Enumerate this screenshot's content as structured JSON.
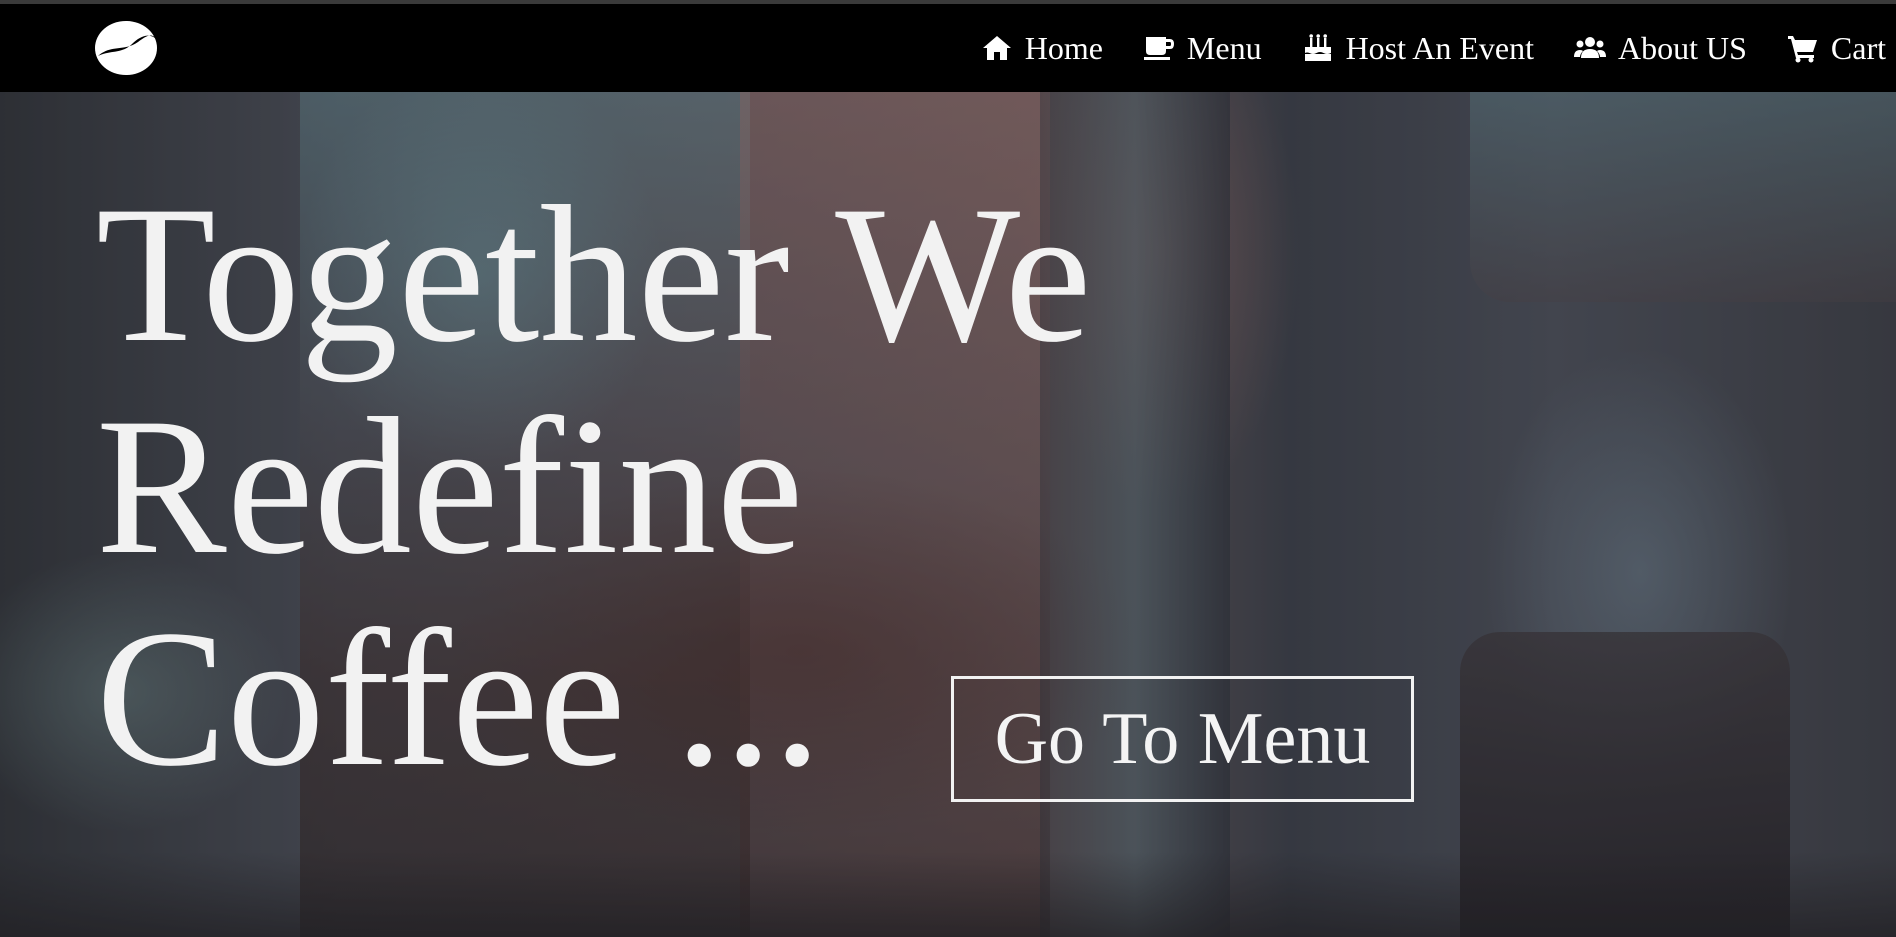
{
  "colors": {
    "navbar_background": "#000000",
    "text": "#ffffff",
    "hero_text": "#f2f2f2",
    "button_border": "#f2f2f2"
  },
  "header": {
    "logo_icon": "coffee-bean-icon",
    "nav": [
      {
        "label": "Home",
        "icon": "home-icon"
      },
      {
        "label": "Menu",
        "icon": "coffee-cup-icon"
      },
      {
        "label": "Host An Event",
        "icon": "birthday-cake-icon"
      },
      {
        "label": "About US",
        "icon": "users-icon"
      },
      {
        "label": "Cart",
        "icon": "shopping-cart-icon"
      }
    ]
  },
  "hero": {
    "headline_lines": [
      "Together We",
      "Redefine",
      "Coffee ..."
    ],
    "cta_label": "Go To Menu"
  }
}
